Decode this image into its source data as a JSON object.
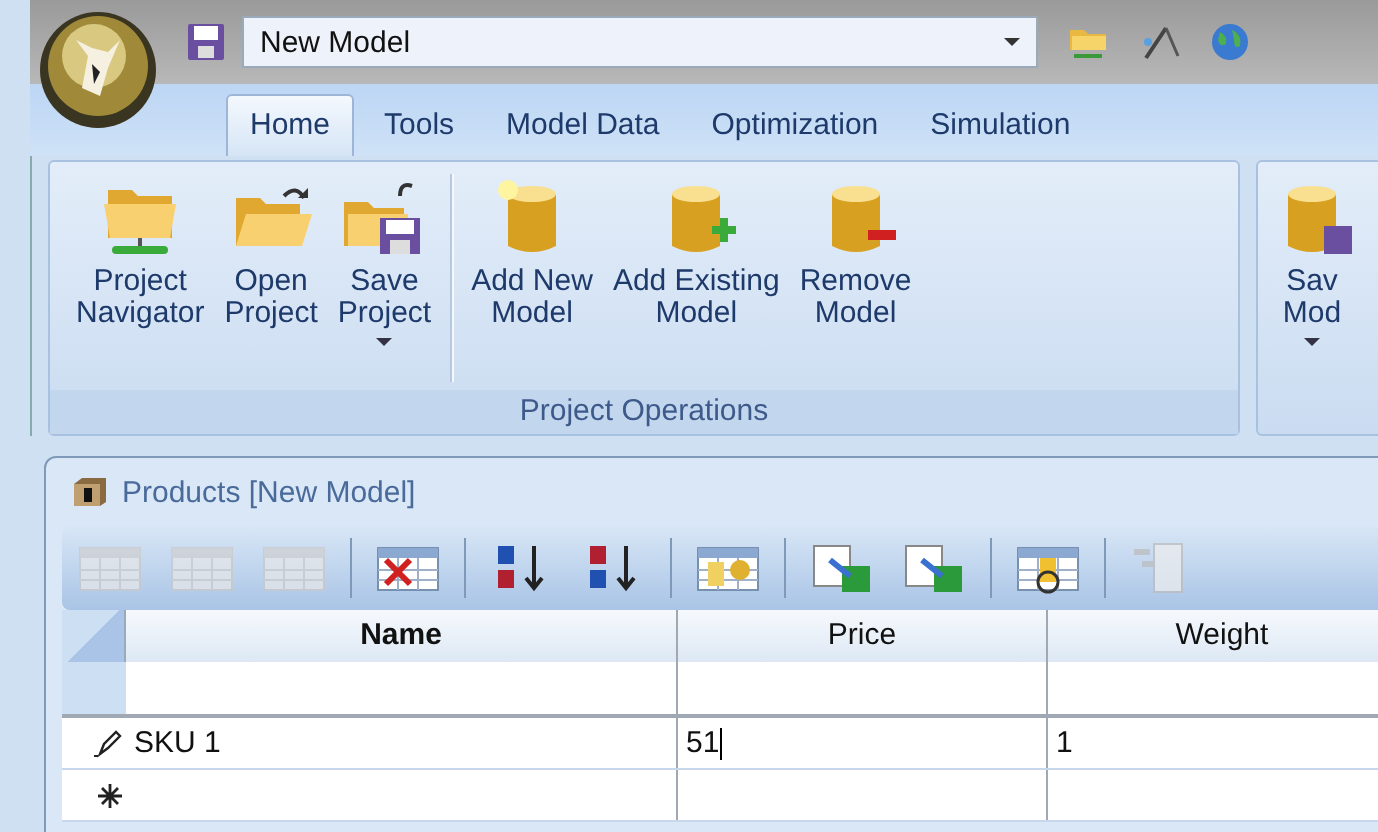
{
  "quick_access": {
    "document": "New Model"
  },
  "tabs": [
    {
      "label": "Home",
      "selected": true
    },
    {
      "label": "Tools",
      "selected": false
    },
    {
      "label": "Model Data",
      "selected": false
    },
    {
      "label": "Optimization",
      "selected": false
    },
    {
      "label": "Simulation",
      "selected": false
    }
  ],
  "ribbon": {
    "groups": [
      {
        "label": "Project Operations",
        "buttons": [
          {
            "kind": "navigator",
            "lines": [
              "Project",
              "Navigator"
            ],
            "dropdown": false
          },
          {
            "kind": "open",
            "lines": [
              "Open",
              "Project"
            ],
            "dropdown": false
          },
          {
            "kind": "save",
            "lines": [
              "Save",
              "Project"
            ],
            "dropdown": true
          },
          {
            "kind": "separator"
          },
          {
            "kind": "new",
            "lines": [
              "Add New",
              "Model"
            ],
            "dropdown": false
          },
          {
            "kind": "add",
            "lines": [
              "Add Existing",
              "Model"
            ],
            "dropdown": false
          },
          {
            "kind": "remove",
            "lines": [
              "Remove",
              "Model"
            ],
            "dropdown": false
          }
        ]
      },
      {
        "buttons": [
          {
            "kind": "save-model",
            "lines": [
              "Sav",
              "Mod"
            ],
            "dropdown": true
          }
        ]
      }
    ]
  },
  "panel": {
    "title": "Products [New Model]",
    "toolbar": [
      {
        "kind": "grid-cut",
        "disabled": true
      },
      {
        "kind": "grid",
        "disabled": true
      },
      {
        "kind": "grid-row",
        "disabled": true
      },
      {
        "kind": "separator"
      },
      {
        "kind": "delete",
        "disabled": false
      },
      {
        "kind": "separator"
      },
      {
        "kind": "sort-asc",
        "disabled": false
      },
      {
        "kind": "sort-desc",
        "disabled": false
      },
      {
        "kind": "separator"
      },
      {
        "kind": "settings",
        "disabled": false
      },
      {
        "kind": "separator"
      },
      {
        "kind": "import",
        "disabled": false
      },
      {
        "kind": "export",
        "disabled": false
      },
      {
        "kind": "separator"
      },
      {
        "kind": "refresh",
        "disabled": false
      },
      {
        "kind": "separator"
      },
      {
        "kind": "tree",
        "disabled": true
      }
    ],
    "table": {
      "columns": [
        {
          "label": "Name",
          "bold": true
        },
        {
          "label": "Price",
          "bold": false
        },
        {
          "label": "Weight",
          "bold": false
        }
      ],
      "rows": [
        {
          "kind": "editing",
          "cells": [
            {
              "value": "SKU 1",
              "cursor": false
            },
            {
              "value": "51",
              "cursor": true
            },
            {
              "value": "1",
              "cursor": false
            }
          ]
        },
        {
          "kind": "new",
          "cells": []
        }
      ]
    }
  }
}
